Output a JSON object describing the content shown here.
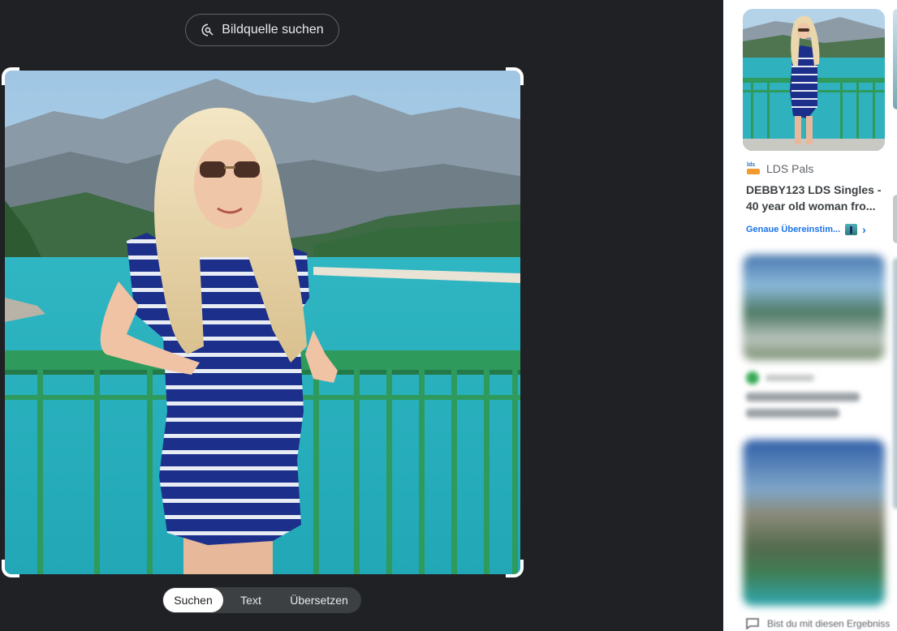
{
  "toolbar": {
    "find_source_label": "Bildquelle suchen",
    "find_source_icon": "image-search-icon"
  },
  "modes": {
    "tabs": [
      {
        "label": "Suchen",
        "active": true
      },
      {
        "label": "Text",
        "active": false
      },
      {
        "label": "Übersetzen",
        "active": false
      }
    ]
  },
  "results": {
    "first": {
      "source_name": "LDS Pals",
      "favicon_text": "lds",
      "title_line1": "DEBBY123 LDS Singles -",
      "title_line2": "40 year old woman fro...",
      "match_label": "Genaue Übereinstim...",
      "chevron": "›"
    },
    "feedback_text": "Bist du mit diesen Ergebniss"
  },
  "colors": {
    "background": "#202124",
    "accent_link": "#1a73e8",
    "results_background": "#ffffff"
  }
}
